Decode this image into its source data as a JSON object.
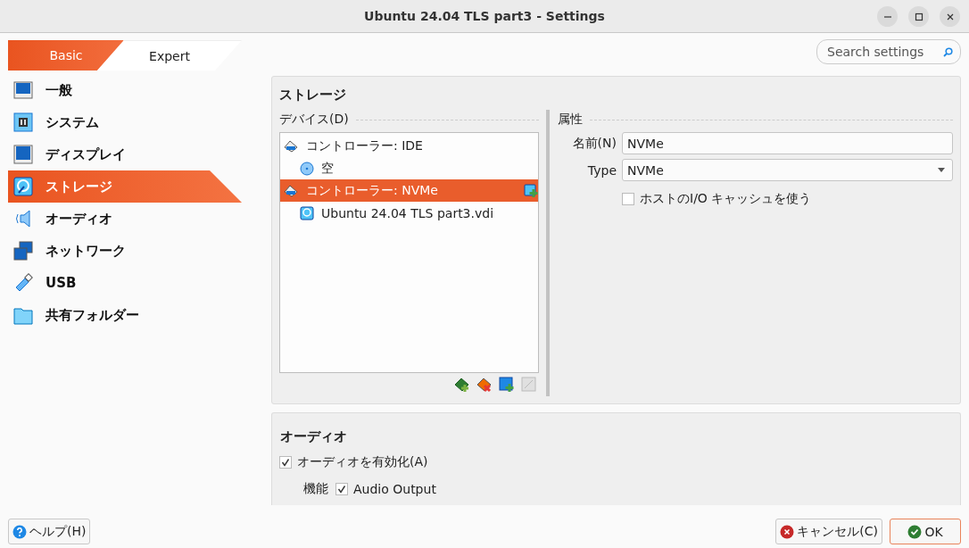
{
  "window": {
    "title": "Ubuntu 24.04 TLS part3 - Settings"
  },
  "mode_tabs": [
    {
      "label": "Basic",
      "selected": true
    },
    {
      "label": "Expert",
      "selected": false
    }
  ],
  "search": {
    "placeholder": "Search settings"
  },
  "sidebar": {
    "items": [
      {
        "label": "一般",
        "kind": "general",
        "selected": false
      },
      {
        "label": "システム",
        "kind": "system",
        "selected": false
      },
      {
        "label": "ディスプレイ",
        "kind": "display",
        "selected": false
      },
      {
        "label": "ストレージ",
        "kind": "storage",
        "selected": true
      },
      {
        "label": "オーディオ",
        "kind": "audio",
        "selected": false
      },
      {
        "label": "ネットワーク",
        "kind": "network",
        "selected": false
      },
      {
        "label": "USB",
        "kind": "usb",
        "selected": false
      },
      {
        "label": "共有フォルダー",
        "kind": "folder",
        "selected": false
      }
    ]
  },
  "storage": {
    "title": "ストレージ",
    "devices_label": "デバイス(D)",
    "tree": [
      {
        "label": "コントローラー: IDE",
        "kind": "controller",
        "selected": false,
        "children": [
          {
            "label": "空",
            "kind": "optical",
            "selected": false
          }
        ]
      },
      {
        "label": "コントローラー: NVMe",
        "kind": "controller",
        "selected": true,
        "children": [
          {
            "label": "Ubuntu 24.04 TLS part3.vdi",
            "kind": "disk",
            "selected": false
          }
        ]
      }
    ],
    "attributes_label": "属性",
    "name_label": "名前(N)",
    "name_value": "NVMe",
    "type_label": "Type",
    "type_value": "NVMe",
    "host_cache": {
      "label": "ホストのI/O キャッシュを使う",
      "checked": false
    }
  },
  "audio": {
    "title": "オーディオ",
    "enable": {
      "label": "オーディオを有効化(A)",
      "checked": true
    },
    "features_label": "機能",
    "output": {
      "label": "Audio Output",
      "checked": true
    }
  },
  "buttons": [
    {
      "label": "ヘルプ(H)",
      "kind": "help"
    },
    {
      "label": "キャンセル(C)",
      "kind": "cancel"
    },
    {
      "label": "OK",
      "kind": "ok"
    }
  ]
}
